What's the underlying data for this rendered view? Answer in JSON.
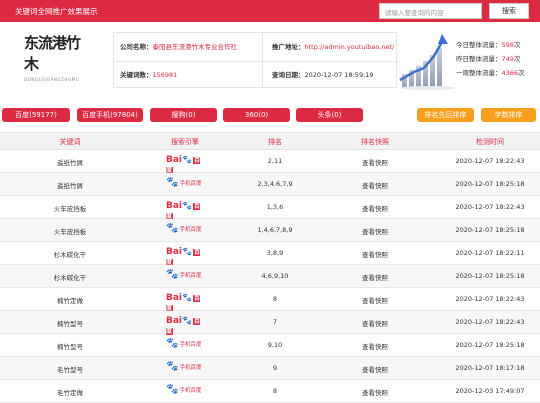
{
  "topbar": {
    "title": "关键词全网推广效果展示",
    "search_placeholder": "请输入要查询的内容",
    "search_button": "搜索"
  },
  "logo": {
    "name": "东流港竹木",
    "pinyin": "DONGLIUGANGZHUMU"
  },
  "info": {
    "company_label": "公司名称：",
    "company_value": "秦阳县东流港竹木专业合作社",
    "address_label": "推广地址：",
    "address_value": "http://admin.youtuibao.net/",
    "keywords_label": "关键词数：",
    "keywords_value": "156981",
    "date_label": "查询日期：",
    "date_value": "2020-12-07 18:59:19"
  },
  "stats": {
    "today_label": "今日整体流量：",
    "today_value": "598",
    "yesterday_label": "昨日整体流量：",
    "yesterday_value": "749",
    "week_label": "一周整体流量：",
    "week_value": "4366",
    "unit": "次"
  },
  "filters": {
    "baidu": "百度(59177)",
    "baidu_mobile": "百度手机(97804)",
    "sogou": "搜狗(0)",
    "so360": "360(0)",
    "toutiao": "头条(0)",
    "sort_rank": "排名先后排序",
    "sort_count": "字数排序"
  },
  "table": {
    "headers": [
      "关键词",
      "搜索引擎",
      "排名",
      "排名快照",
      "检测时间"
    ],
    "rows": [
      {
        "keyword": "遥纸竹屑",
        "engine": "baidu",
        "rank": "2,11",
        "snapshot": "查看快照",
        "time": "2020-12-07 18:22:43"
      },
      {
        "keyword": "遥纸竹屑",
        "engine": "baidu_mobile",
        "rank": "2,3,4,6,7,9",
        "snapshot": "查看快照",
        "time": "2020-12-07 18:25:18"
      },
      {
        "keyword": "火车皮挡板",
        "engine": "baidu",
        "rank": "1,3,6",
        "snapshot": "查看快照",
        "time": "2020-12-07 18:22:43"
      },
      {
        "keyword": "火车皮挡板",
        "engine": "baidu_mobile",
        "rank": "1,4,6,7,8,9",
        "snapshot": "查看快照",
        "time": "2020-12-07 18:25:18"
      },
      {
        "keyword": "杉木碳化干",
        "engine": "baidu",
        "rank": "3,8,9",
        "snapshot": "查看快照",
        "time": "2020-12-07 18:22:11"
      },
      {
        "keyword": "杉木碳化干",
        "engine": "baidu_mobile",
        "rank": "4,6,9,10",
        "snapshot": "查看快照",
        "time": "2020-12-07 18:25:18"
      },
      {
        "keyword": "楠竹定做",
        "engine": "baidu",
        "rank": "8",
        "snapshot": "查看快照",
        "time": "2020-12-07 18:22:43"
      },
      {
        "keyword": "楠竹型号",
        "engine": "baidu",
        "rank": "7",
        "snapshot": "查看快照",
        "time": "2020-12-07 18:22:43"
      },
      {
        "keyword": "楠竹型号",
        "engine": "baidu_mobile",
        "rank": "9,10",
        "snapshot": "查看快照",
        "time": "2020-12-07 18:25:18"
      },
      {
        "keyword": "毛竹型号",
        "engine": "baidu_mobile",
        "rank": "9",
        "snapshot": "查看快照",
        "time": "2020-12-07 18:17:18"
      },
      {
        "keyword": "毛竹定做",
        "engine": "baidu_mobile",
        "rank": "8",
        "snapshot": "查看快照",
        "time": "2020-12-03 17:49:07"
      }
    ]
  },
  "engine_logos": {
    "baidu_text": "Bai",
    "baidu_cn": "百度",
    "mobile_cn": "手机百度"
  },
  "colors": {
    "brand_red": "#dc2a43",
    "orange": "#f8a01d",
    "baidu_blue": "#2c3fc9"
  }
}
